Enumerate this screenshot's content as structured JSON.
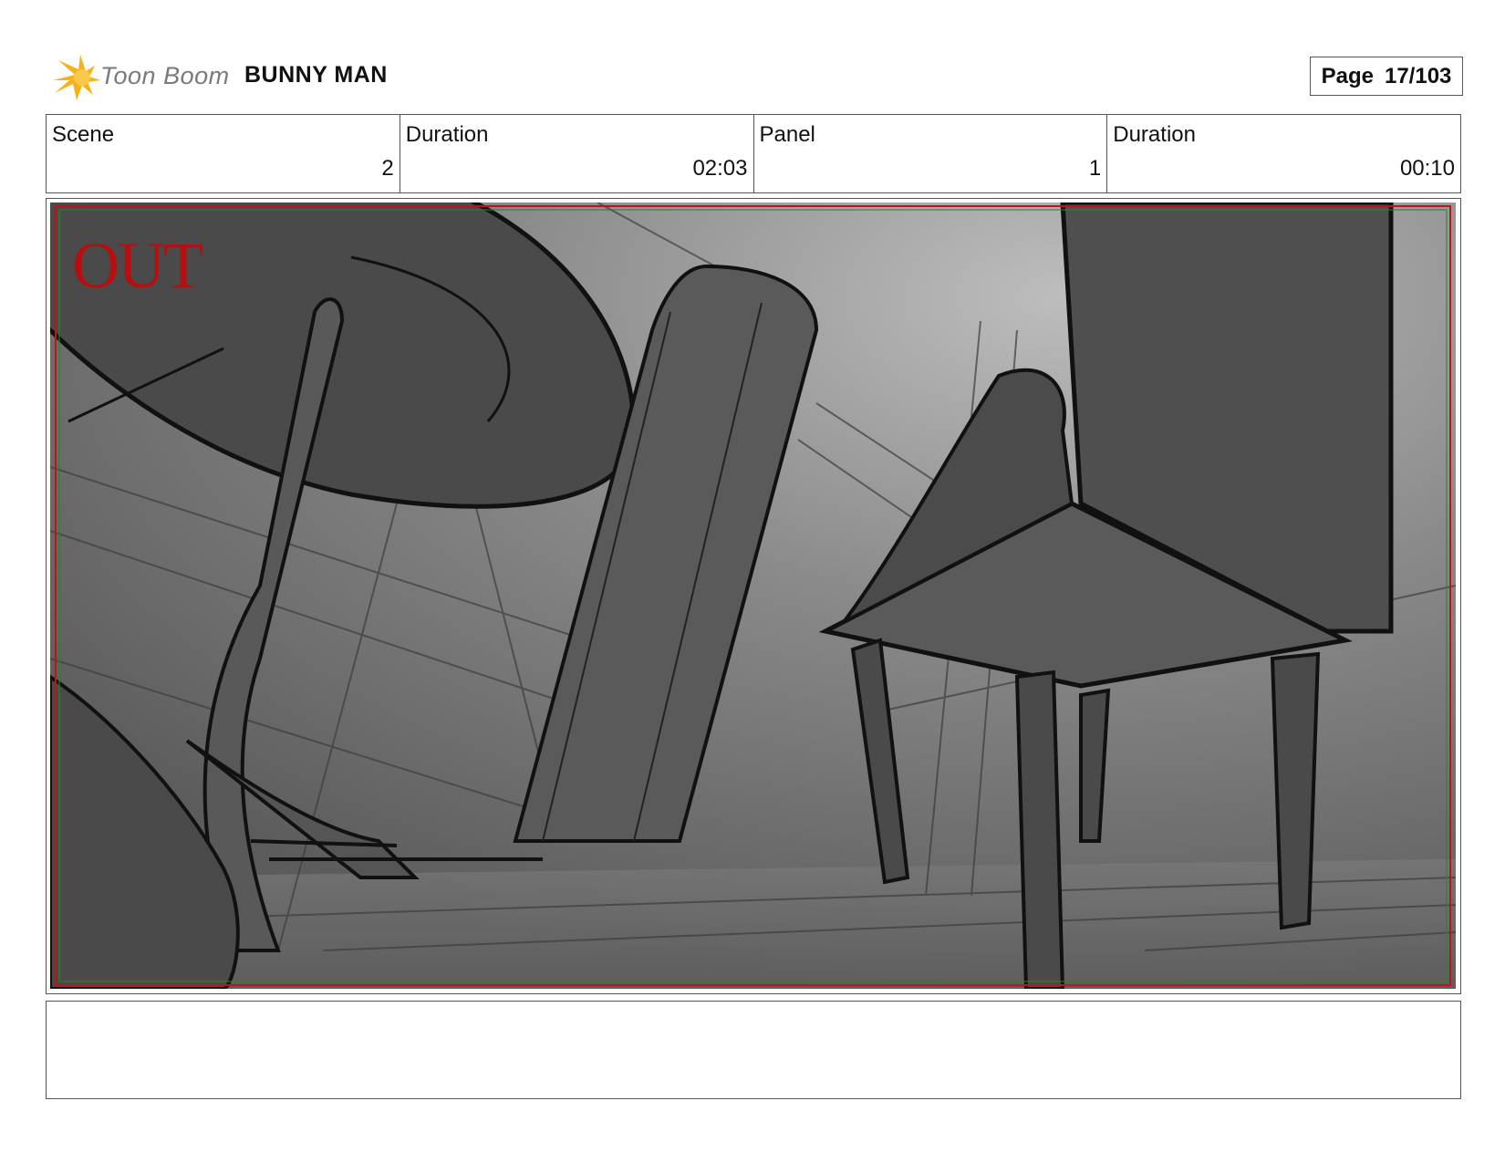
{
  "header": {
    "logo_text": "Toon Boom",
    "project_title": "BUNNY MAN",
    "page_label": "Page",
    "page_number": "17/103"
  },
  "info": {
    "scene_label": "Scene",
    "scene_value": "2",
    "scene_duration_label": "Duration",
    "scene_duration_value": "02:03",
    "panel_label": "Panel",
    "panel_value": "1",
    "panel_duration_label": "Duration",
    "panel_duration_value": "00:10"
  },
  "panel": {
    "overlay_text": "OUT"
  },
  "notes": {
    "text": ""
  },
  "colors": {
    "logo_accent": "#f5b21b",
    "out_text": "#b50f12",
    "safe_frame_red": "#c0121a",
    "safe_frame_green": "#1f8a2a"
  }
}
